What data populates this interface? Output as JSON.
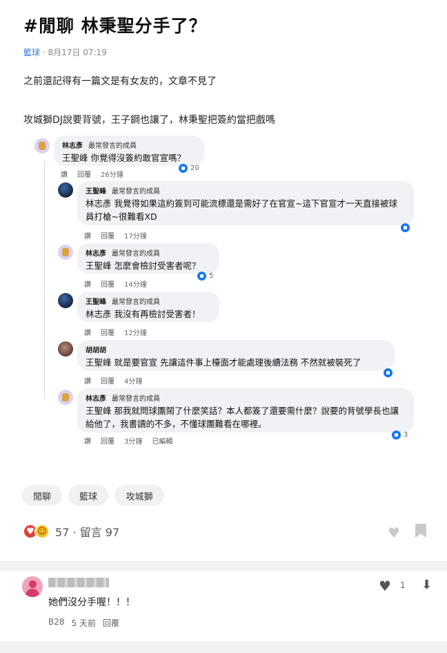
{
  "post": {
    "title": "#閒聊 林秉聖分手了？",
    "board": "籃球",
    "separator": "·",
    "date": "8月17日 07:19",
    "lines": [
      "之前還記得有一篇文是有女友的，文章不見了",
      "攻城獅DJ說要背號，王子鋼也讓了，林秉聖把簽約當把戲嗎"
    ]
  },
  "embedded_comments": [
    {
      "name": "林志彥",
      "badge": "最常發言的成員",
      "text": "王聖峰 你覺得沒簽約敢官宣嗎？",
      "actions": [
        "讚",
        "回覆"
      ],
      "time": "26分鐘",
      "likes": "20",
      "avatar": "profile-icon"
    },
    {
      "name": "王聖峰",
      "badge": "最常發言的成員",
      "text": "林志彥 我覺得如果這約簽到可能流標還是需好了在官宣~這下官宣才一天直接被球員打槍~很難看XD",
      "actions": [
        "讚",
        "回覆"
      ],
      "time": "17分鐘",
      "likes": "",
      "avatar": "profile-icon"
    },
    {
      "name": "林志彥",
      "badge": "最常發言的成員",
      "text": "王聖峰 怎麼會檢討受害者呢？",
      "actions": [
        "讚",
        "回覆"
      ],
      "time": "14分鐘",
      "likes": "5",
      "avatar": "profile-icon"
    },
    {
      "name": "王聖峰",
      "badge": "最常發言的成員",
      "text": "林志彥 我沒有再檢討受害者！",
      "actions": [
        "讚",
        "回覆"
      ],
      "time": "12分鐘",
      "likes": "",
      "avatar": "profile-icon"
    },
    {
      "name": "胡胡胡",
      "badge": "",
      "text": "王聖峰 就是要官宣 先讓這件事上檯面才能處理後續法務 不然就被裝死了",
      "actions": [
        "讚",
        "回覆"
      ],
      "time": "4分鐘",
      "likes": "",
      "avatar": "profile-icon"
    },
    {
      "name": "林志彥",
      "badge": "最常發言的成員",
      "text": "王聖峰 那我就問球團鬧了什麼笑話？本人都簽了還要需什麼？說要的背號學長也讓給他了，我書讀的不多，不懂球團難看在哪裡。",
      "actions": [
        "讚",
        "回覆"
      ],
      "time": "3分鐘",
      "edited": "已編輯",
      "likes": "3",
      "avatar": "profile-icon"
    }
  ],
  "tags": [
    "閒聊",
    "籃球",
    "攻城獅"
  ],
  "reactions": {
    "count": "57",
    "separator": "·",
    "comments_label": "留言 97",
    "icons": [
      "heart-reaction-icon",
      "laugh-reaction-icon"
    ]
  },
  "bottom_comment": {
    "text": "她們沒分手喔！！！",
    "floor": "B28",
    "time": "5 天前",
    "reply_label": "回覆",
    "likes": "1"
  },
  "colors": {
    "link_blue": "#3a7bd5",
    "like_blue": "#1877f2",
    "bubble_gray": "#f0f2f5",
    "heart_red": "#e0403a"
  }
}
